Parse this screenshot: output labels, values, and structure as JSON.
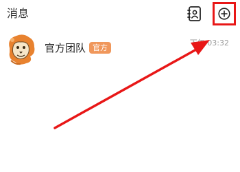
{
  "header": {
    "title": "消息",
    "contacts_icon": "contacts-book-icon",
    "add_icon": "plus-circle-icon"
  },
  "conversations": [
    {
      "name": "官方团队",
      "badge": "官方",
      "time": "下午 03:32",
      "avatar_icon": "orange-lion-mascot-avatar"
    }
  ],
  "annotation": {
    "highlight_color": "#e81717",
    "arrow_color": "#e81717"
  },
  "colors": {
    "badge_bg": "#f0975b",
    "avatar_orange": "#e8822f"
  }
}
